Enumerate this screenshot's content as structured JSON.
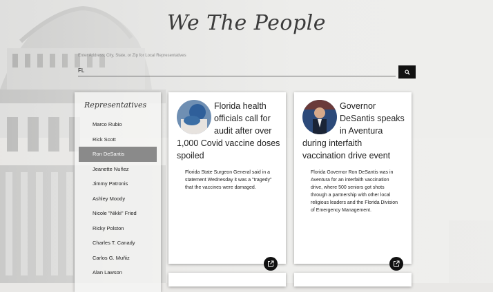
{
  "app_title": "We The People",
  "search": {
    "label": "Enter Address, City, State, or Zip for Local Representatives",
    "value": "FL",
    "button_icon": "search-icon"
  },
  "sidebar": {
    "title": "Representatives",
    "items": [
      {
        "label": "Marco Rubio"
      },
      {
        "label": "Rick Scott"
      },
      {
        "label": "Ron DeSantis",
        "active": true
      },
      {
        "label": "Jeanette Nuñez"
      },
      {
        "label": "Jimmy Patronis"
      },
      {
        "label": "Ashley Moody"
      },
      {
        "label": "Nicole \"Nikki\" Fried"
      },
      {
        "label": "Ricky Polston"
      },
      {
        "label": "Charles T. Canady"
      },
      {
        "label": "Carlos G. Muñiz"
      },
      {
        "label": "Alan Lawson"
      }
    ]
  },
  "articles": [
    {
      "headline": "Florida health officials call for audit after over 1,000 Covid vaccine doses spoiled",
      "summary": "Florida State Surgeon General said in a statement Wednesday it was a \"tragedy\" that the vaccines were damaged.",
      "link_icon": "external-link-icon"
    },
    {
      "headline": "Governor DeSantis speaks in Aventura during interfaith vaccination drive event",
      "summary": "Florida Governor Ron DeSantis was in Aventura for an interfaith vaccination drive, where 500 seniors got shots through a partnership with other local religious leaders and the Florida Division of Emergency Management.",
      "link_icon": "external-link-icon"
    }
  ],
  "colors": {
    "accent": "#111111",
    "active_item": "#8a8a8a"
  }
}
